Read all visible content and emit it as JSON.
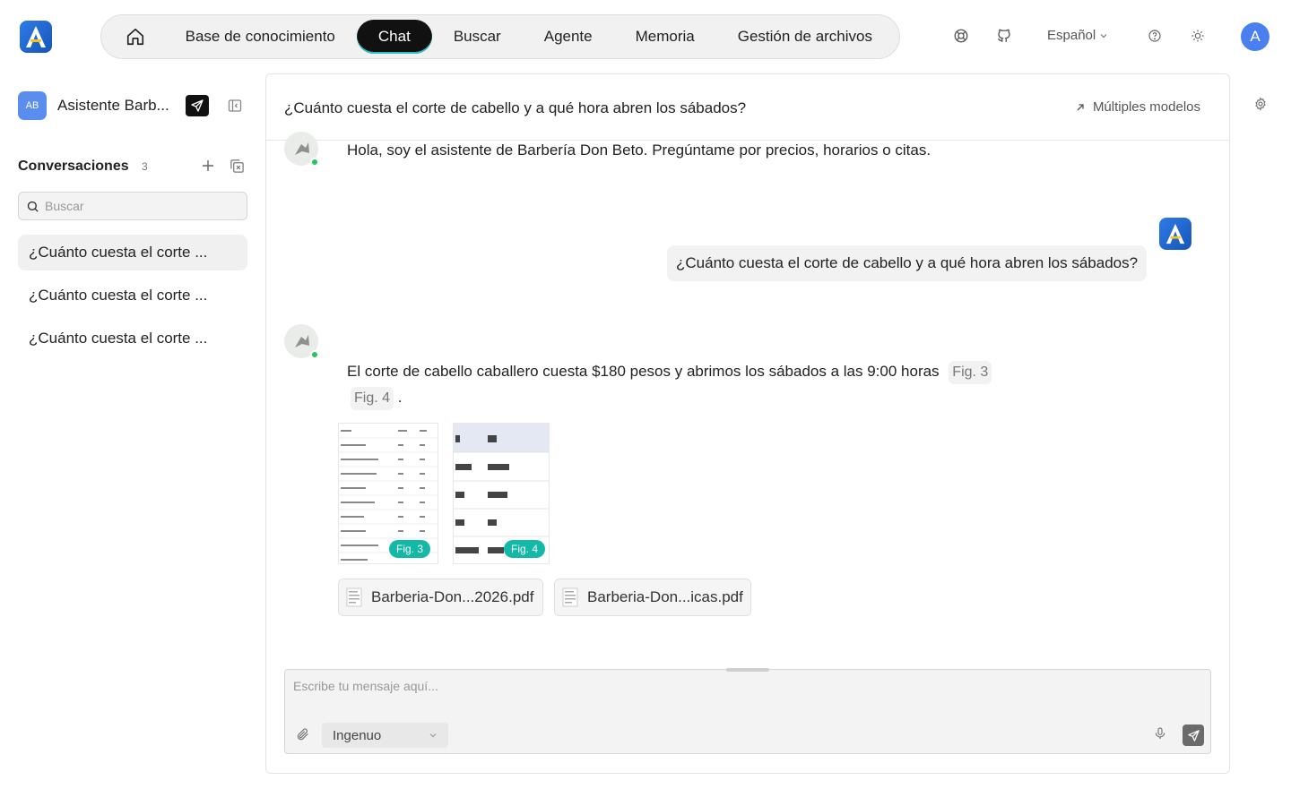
{
  "topbar": {
    "logo_letter": "A",
    "nav": [
      {
        "label": "Base de conocimiento"
      },
      {
        "label": "Chat"
      },
      {
        "label": "Buscar"
      },
      {
        "label": "Agente"
      },
      {
        "label": "Memoria"
      },
      {
        "label": "Gestión de archivos"
      }
    ],
    "active_nav": "Chat",
    "language": "Español",
    "user_initial": "A",
    "icons": [
      "home-icon",
      "support-icon",
      "github-icon",
      "chevron-down-icon",
      "help-icon",
      "sun-icon"
    ]
  },
  "sidebar": {
    "assistant_badge": "AB",
    "assistant_name": "Asistente Barb...",
    "conversations_label": "Conversaciones",
    "conversations_count": "3",
    "search_placeholder": "Buscar",
    "items": [
      {
        "label": "¿Cuánto cuesta el corte ..."
      },
      {
        "label": "¿Cuánto cuesta el corte ..."
      },
      {
        "label": "¿Cuánto cuesta el corte ..."
      }
    ]
  },
  "chat": {
    "title": "¿Cuánto cuesta el corte de cabello y a qué hora abren los sábados?",
    "multi_models": "Múltiples modelos",
    "greeting": "Hola, soy el asistente de Barbería Don Beto. Pregúntame por precios, horarios o citas.",
    "user_message": "¿Cuánto cuesta el corte de cabello y a qué hora abren los sábados?",
    "user_avatar_letter": "A",
    "answer_text": "El corte de cabello caballero cuesta $180 pesos y abrimos los sábados a las 9:00 horas",
    "fig_ref_1": "Fig. 3",
    "fig_ref_2": "Fig. 4",
    "answer_end": ".",
    "thumb_tag_1": "Fig. 3",
    "thumb_tag_2": "Fig. 4",
    "files": [
      {
        "name": "Barberia-Don...2026.pdf"
      },
      {
        "name": "Barberia-Don...icas.pdf"
      }
    ]
  },
  "composer": {
    "placeholder": "Escribe tu mensaje aquí...",
    "model": "Ingenuo"
  },
  "colors": {
    "accent": "#14b8a6",
    "nav_active_bg": "#111111",
    "online": "#22c55e",
    "brand_blue": "#2f7be8"
  }
}
